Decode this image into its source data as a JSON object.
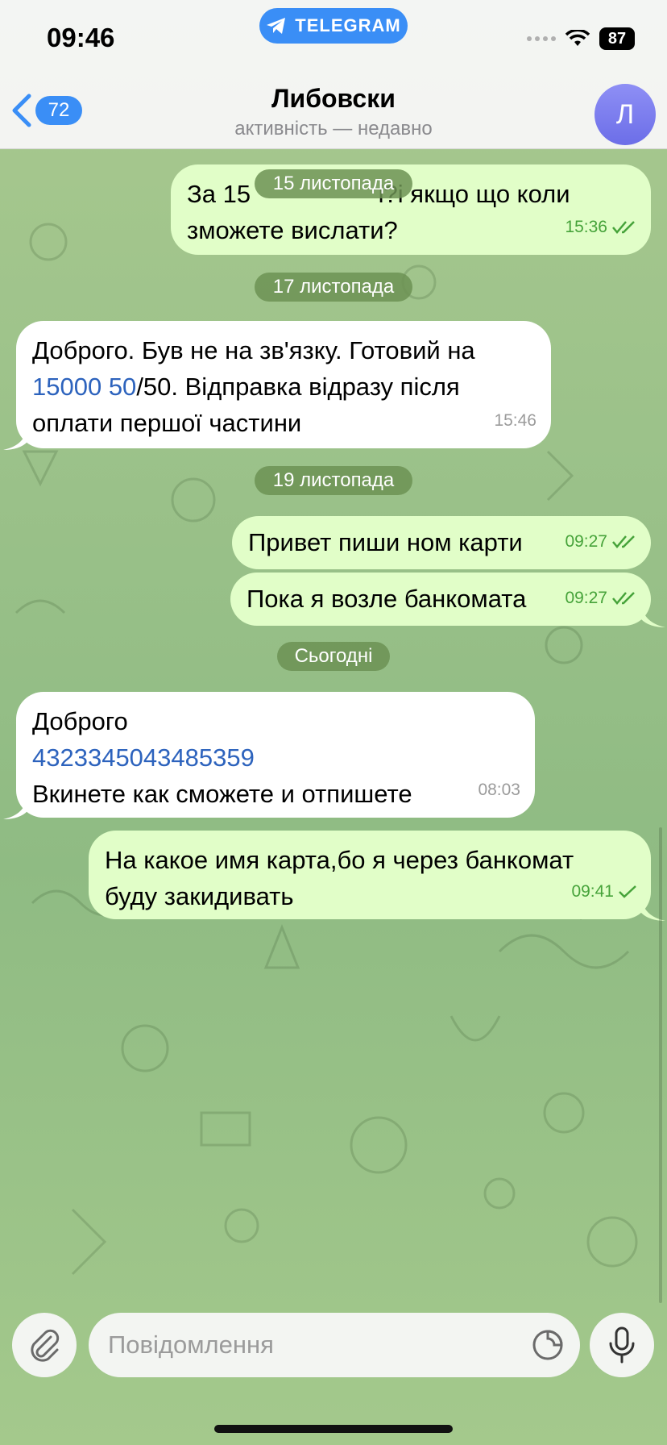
{
  "status_bar": {
    "time": "09:46",
    "app_pill": "TELEGRAM",
    "battery": "87"
  },
  "header": {
    "back_count": "72",
    "title": "Либовски",
    "status": "активність — недавно",
    "avatar_letter": "Л"
  },
  "dates": {
    "d1": "15 листопада",
    "d2": "17 листопада",
    "d3": "19 листопада",
    "d4": "Сьогодні"
  },
  "messages": {
    "m1": {
      "line1": "За 15 ",
      "line1_tail": "і?і якщо що коли",
      "line2": "зможете вислати?",
      "time": "15:36"
    },
    "m2": {
      "line1": "Доброго. Був не на зв'язку. Готовий на",
      "link": "15000 50",
      "line2_rest": "/50. Відправка відразу після",
      "line3": "оплати першої частини",
      "time": "15:46"
    },
    "m3": {
      "text": "Привет пиши ном карти",
      "time": "09:27"
    },
    "m4": {
      "text": "Пока я возле банкомата",
      "time": "09:27"
    },
    "m5": {
      "line1": "Доброго",
      "link": "4323345043485359",
      "line3": "Вкинете как сможете и отпишете",
      "time": "08:03"
    },
    "m6": {
      "line1": "На какое имя карта,бо я через банкомат",
      "line2": "буду закидивать",
      "time": "09:41"
    }
  },
  "composer": {
    "placeholder": "Повідомлення"
  },
  "colors": {
    "accent": "#3a8ef6",
    "outgoing_bubble": "#e1fec8",
    "incoming_bubble": "#ffffff",
    "check_green": "#46a33a"
  }
}
